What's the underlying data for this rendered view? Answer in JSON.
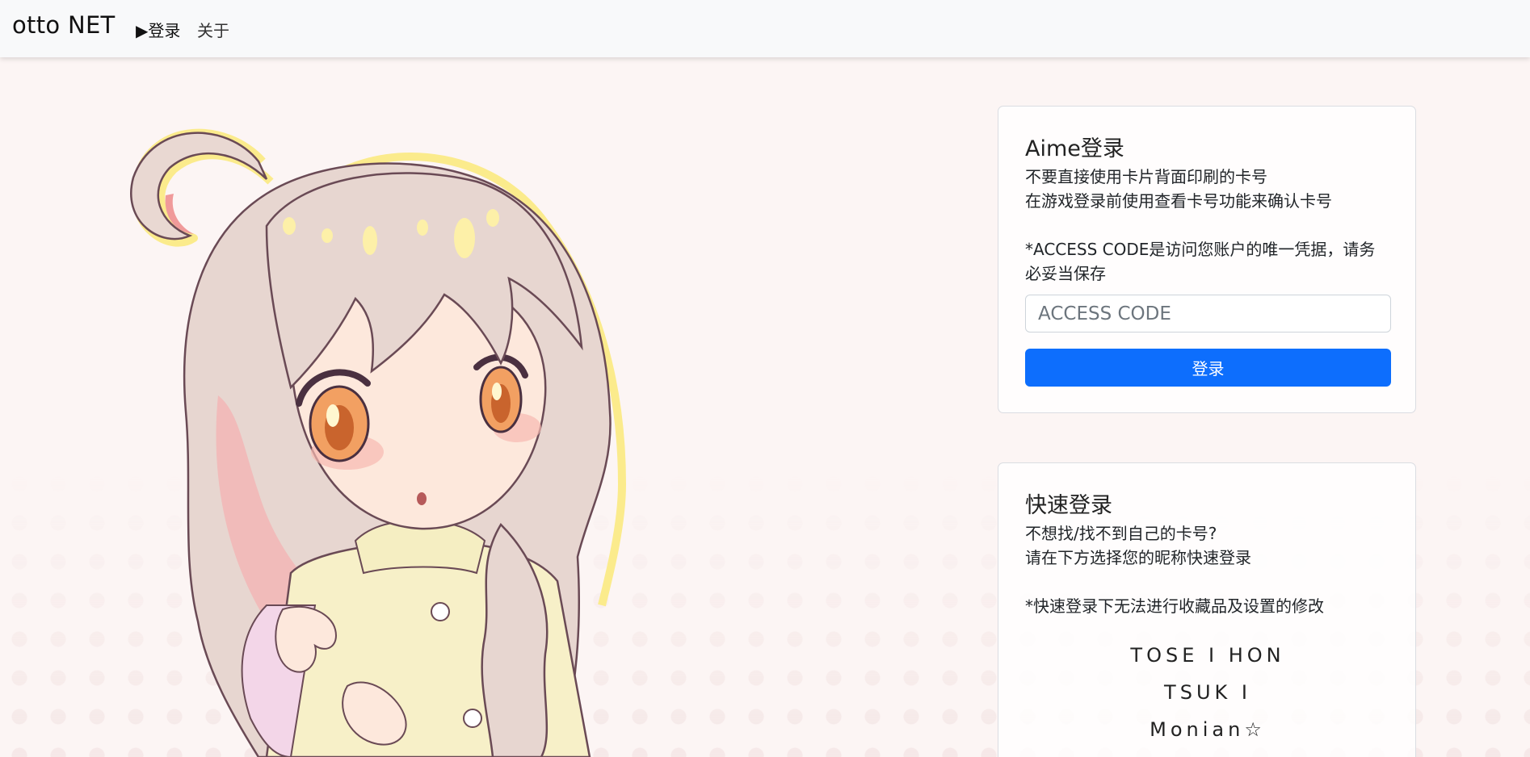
{
  "navbar": {
    "brand": "otto NET",
    "links": [
      {
        "label": "▶登录"
      },
      {
        "label": "关于"
      }
    ]
  },
  "aime_card": {
    "title": "Aime登录",
    "line1": "不要直接使用卡片背面印刷的卡号",
    "line2": "在游戏登录前使用查看卡号功能来确认卡号",
    "note": "*ACCESS CODE是访问您账户的唯一凭据，请务必妥当保存",
    "input_placeholder": "ACCESS CODE",
    "button_label": "登录"
  },
  "quick_card": {
    "title": "快速登录",
    "line1": "不想找/找不到自己的卡号?",
    "line2": "请在下方选择您的昵称快速登录",
    "note": "*快速登录下无法进行收藏品及设置的修改",
    "nicknames": [
      "TOSE I HON",
      "TSUK I",
      "Monian☆"
    ]
  },
  "colors": {
    "primary_button": "#0d6efd",
    "navbar_bg": "#f8f9fa",
    "page_bg": "#fcf5f4"
  },
  "icons": {
    "character_illustration": "anime-girl-illustration"
  }
}
